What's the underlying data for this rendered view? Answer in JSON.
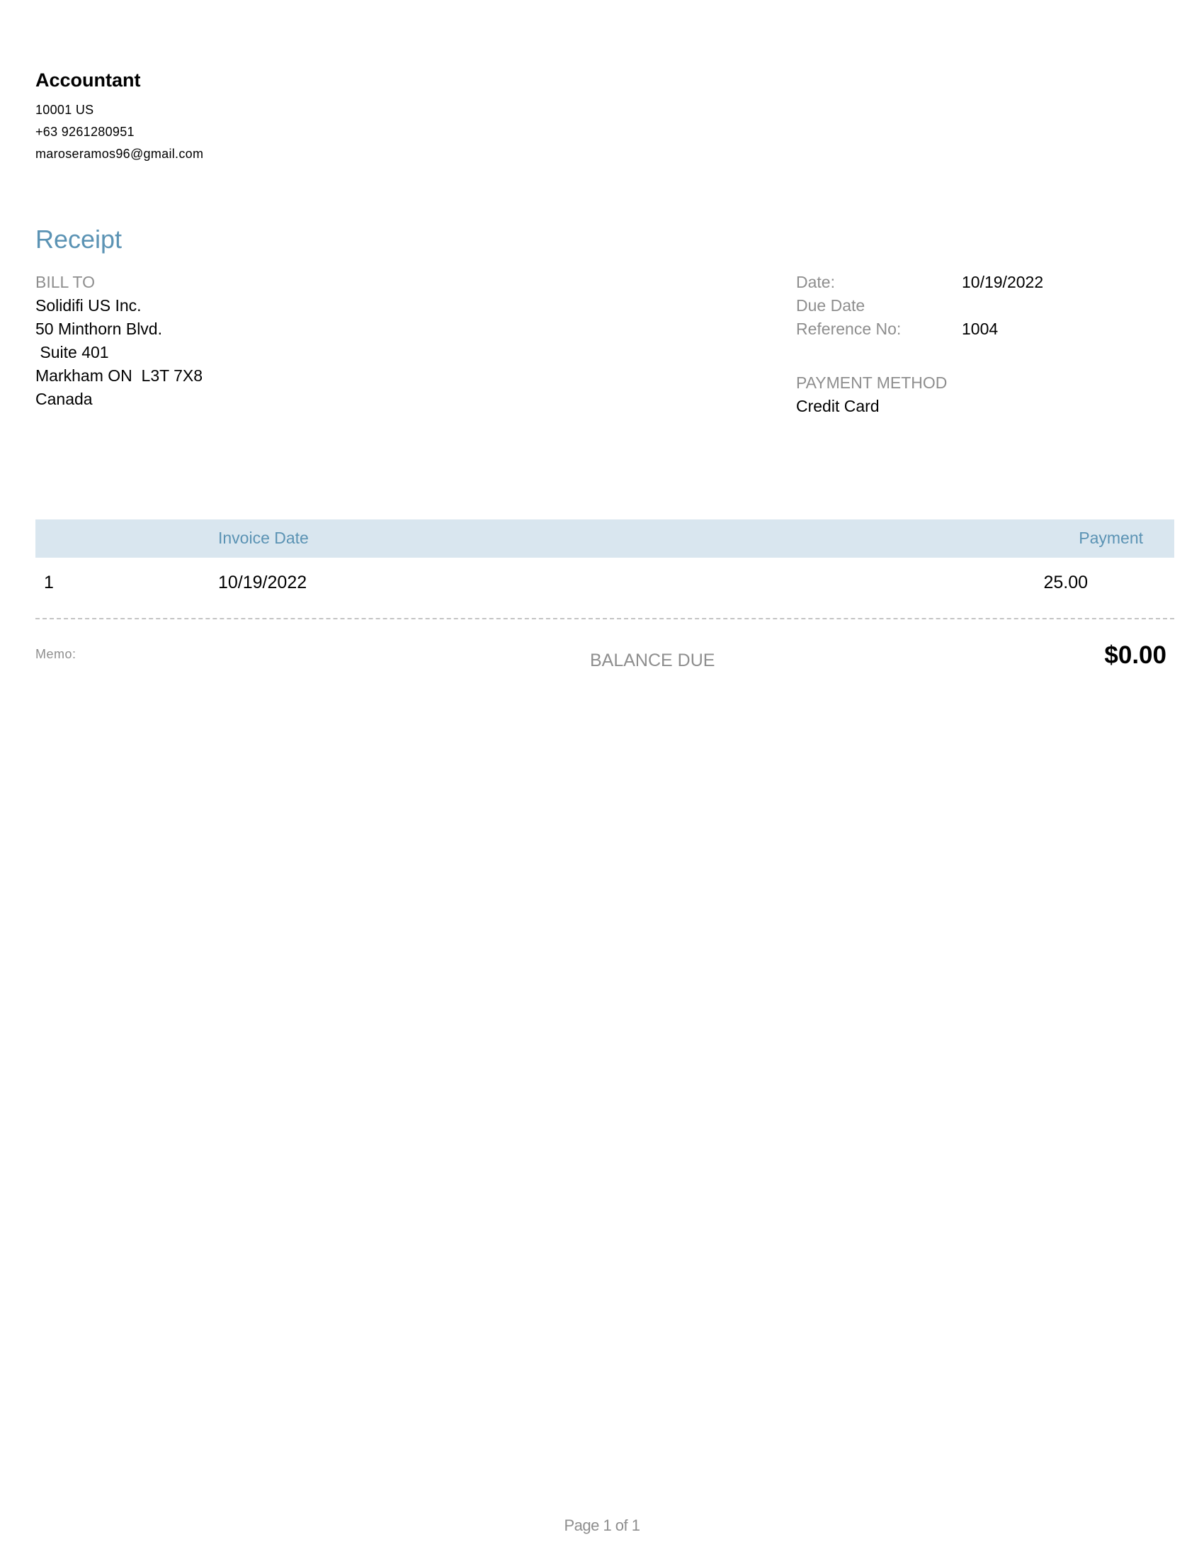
{
  "company": {
    "name": "Accountant",
    "address": "10001 US",
    "phone": "+63 9261280951",
    "email": "maroseramos96@gmail.com"
  },
  "document": {
    "title": "Receipt"
  },
  "bill_to": {
    "label": "BILL TO",
    "lines": [
      "Solidifi US Inc.",
      "50 Minthorn Blvd.",
      " Suite 401",
      "Markham ON  L3T 7X8",
      "Canada"
    ]
  },
  "details": {
    "date_label": "Date:",
    "date_value": "10/19/2022",
    "due_date_label": "Due Date",
    "due_date_value": "",
    "reference_label": "Reference No:",
    "reference_value": "1004",
    "payment_method_label": "PAYMENT METHOD",
    "payment_method_value": "Credit Card"
  },
  "table": {
    "headers": {
      "number": "",
      "invoice_date": "Invoice Date",
      "payment": "Payment"
    },
    "rows": [
      {
        "number": "1",
        "invoice_date": "10/19/2022",
        "payment": "25.00"
      }
    ]
  },
  "summary": {
    "memo_label": "Memo:",
    "balance_due_label": "BALANCE DUE",
    "balance_due_value": "$0.00"
  },
  "footer": {
    "page_text": "Page 1 of 1"
  }
}
